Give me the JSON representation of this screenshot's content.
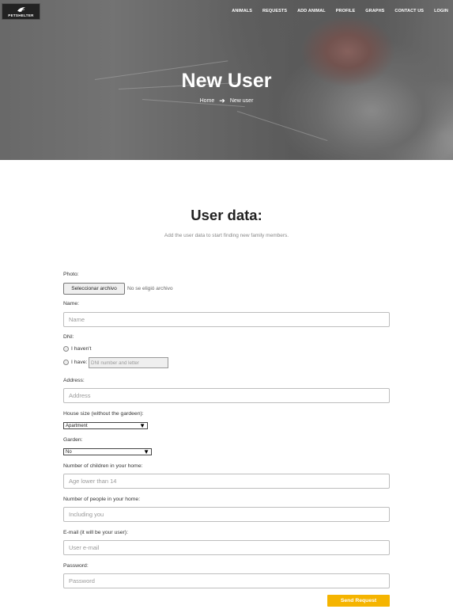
{
  "brand": {
    "logo_text": "PETSHELTER"
  },
  "nav": {
    "items": [
      "ANIMALS",
      "REQUESTS",
      "ADD ANIMAL",
      "PROFILE",
      "GRAPHS",
      "CONTACT US",
      "LOGIN"
    ]
  },
  "hero": {
    "title": "New User",
    "breadcrumb": {
      "home": "Home",
      "separator_icon": "arrow-right-icon",
      "current": "New user"
    }
  },
  "section": {
    "title": "User data:",
    "subtitle": "Add the user data to start finding new family members."
  },
  "form": {
    "photo": {
      "label": "Photo:",
      "button": "Seleccionar archivo",
      "status": "No se eligió archivo"
    },
    "name": {
      "label": "Name:",
      "placeholder": "Name",
      "value": ""
    },
    "dni": {
      "label": "DNI:",
      "option_none": "I haven't",
      "option_have": "I have:",
      "placeholder": "DNI number and letter"
    },
    "address": {
      "label": "Address:",
      "placeholder": "Address",
      "value": ""
    },
    "house_size": {
      "label": "House size (without the gardeen):",
      "selected": "Apartment"
    },
    "garden": {
      "label": "Garden:",
      "selected": "No"
    },
    "children": {
      "label": "Number of children in your home:",
      "placeholder": "Age lower than 14"
    },
    "people": {
      "label": "Number of people in your home:",
      "placeholder": "Including you"
    },
    "email": {
      "label": "E-mail (it will be your user):",
      "placeholder": "User e-mail"
    },
    "password": {
      "label": "Password:",
      "placeholder": "Password"
    },
    "submit": "Send Request"
  },
  "colors": {
    "accent": "#f5b400",
    "text": "#333333",
    "muted": "#888888",
    "input_border": "#bdbdbd"
  }
}
